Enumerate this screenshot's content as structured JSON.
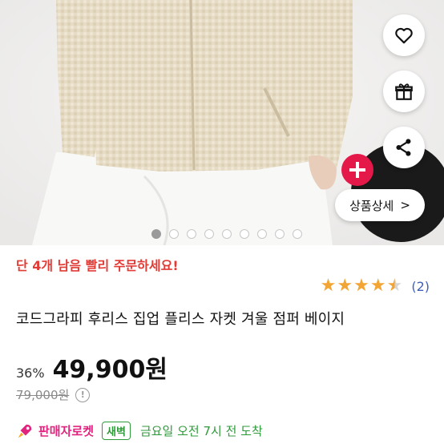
{
  "product": {
    "stock_notice": "단 4개 남음 빨리 주문하세요!",
    "title": "코드그라피 후리스 집업 플리스 자켓 겨울 점퍼 베이지",
    "discount": "36%",
    "price": "49,900원",
    "original_price": "79,000원",
    "rating": {
      "stars": 4.5,
      "count": "(2)"
    }
  },
  "gallery": {
    "detail_button_label": "상품상세",
    "detail_button_arrow": ">",
    "dot_count": 9,
    "active_dot": 0,
    "add_badge_symbol": "+"
  },
  "actions": {
    "like_icon": "heart-icon",
    "gift_icon": "gift-icon",
    "share_icon": "share-icon"
  },
  "delivery": {
    "seller_label": "판매자로켓",
    "badge": "새벽",
    "arrival": "금요일 오전 7시 전 도착"
  },
  "info_icon_glyph": "!",
  "colors": {
    "stock_red": "#e23a35",
    "star": "#f2a534",
    "rating_link": "#3f5fbe",
    "rocket_pink": "#e0247e",
    "dawn_green": "#2f9a3a"
  }
}
